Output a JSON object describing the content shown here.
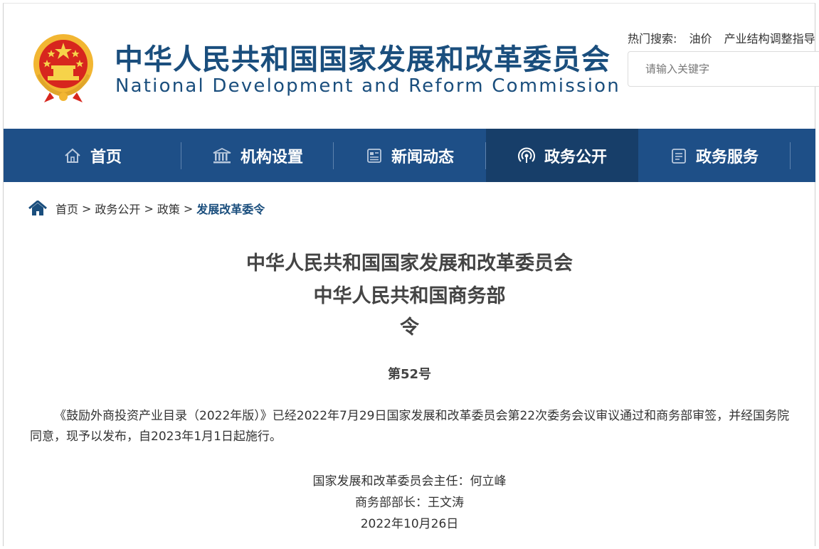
{
  "header": {
    "title_cn": "中华人民共和国国家发展和改革委员会",
    "title_en": "National Development and Reform Commission",
    "hot_search_label": "热门搜索:",
    "hot_search_items": [
      "油价",
      "产业结构调整指导"
    ],
    "search_placeholder": "请输入关键字"
  },
  "nav": {
    "items": [
      {
        "label": "首页",
        "icon": "home-icon"
      },
      {
        "label": "机构设置",
        "icon": "institution-icon"
      },
      {
        "label": "新闻动态",
        "icon": "news-icon"
      },
      {
        "label": "政务公开",
        "icon": "broadcast-icon",
        "active": true
      },
      {
        "label": "政务服务",
        "icon": "service-icon"
      }
    ]
  },
  "breadcrumb": {
    "items": [
      "首页",
      "政务公开",
      "政策"
    ],
    "current": "发展改革委令",
    "separator": ">"
  },
  "article": {
    "heading_1": "中华人民共和国国家发展和改革委员会",
    "heading_2": "中华人民共和国商务部",
    "heading_3": "令",
    "doc_number": "第52号",
    "body": "《鼓励外商投资产业目录（2022年版）》已经2022年7月29日国家发展和改革委员会第22次委务会议审议通过和商务部审签，并经国务院同意，现予以发布，自2023年1月1日起施行。",
    "signature_1": "国家发展和改革委员会主任：何立峰",
    "signature_2": "商务部部长：王文涛",
    "date": "2022年10月26日"
  },
  "colors": {
    "brand_blue": "#1a4e7d",
    "nav_bg": "#1e4f87",
    "nav_active": "#173e69",
    "emblem_red": "#d7261e",
    "emblem_gold": "#f2b632"
  }
}
